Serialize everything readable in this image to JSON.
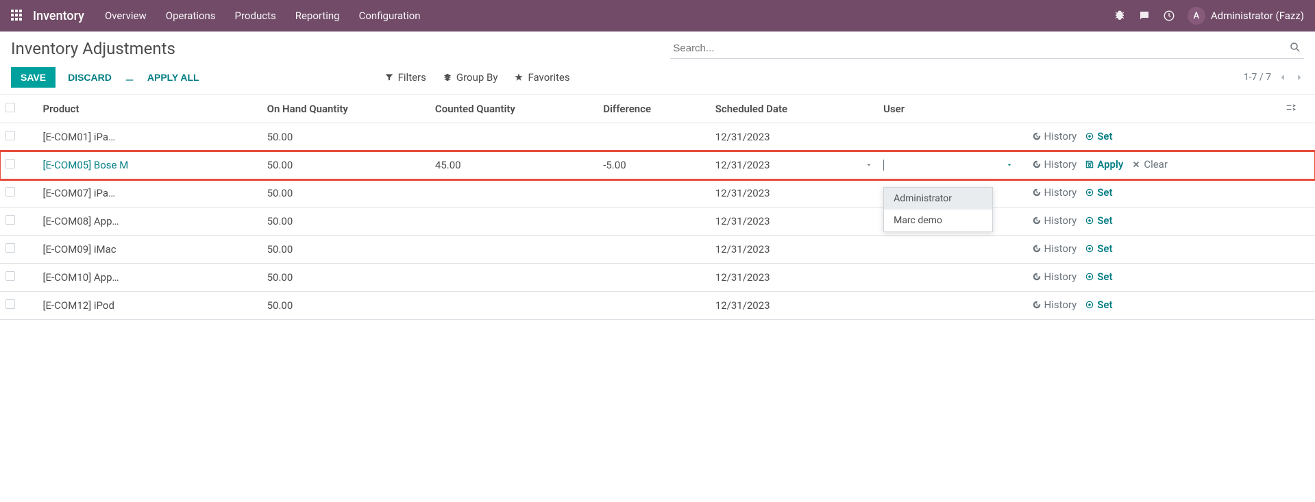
{
  "topnav": {
    "app": "Inventory",
    "menu": [
      "Overview",
      "Operations",
      "Products",
      "Reporting",
      "Configuration"
    ],
    "user_initial": "A",
    "user_label": "Administrator (Fazz)"
  },
  "cp": {
    "title": "Inventory Adjustments",
    "search_placeholder": "Search...",
    "save": "SAVE",
    "discard": "DISCARD",
    "apply_all": "APPLY ALL",
    "filters": "Filters",
    "groupby": "Group By",
    "favorites": "Favorites",
    "pager": "1-7 / 7"
  },
  "table": {
    "headers": {
      "product": "Product",
      "onhand": "On Hand Quantity",
      "counted": "Counted Quantity",
      "diff": "Difference",
      "date": "Scheduled Date",
      "user": "User"
    },
    "history": "History",
    "set": "Set",
    "apply": "Apply",
    "clear": "Clear",
    "rows": [
      {
        "product": "[E-COM01] iPa…",
        "onhand": "50.00",
        "counted": "",
        "diff": "",
        "date": "12/31/2023",
        "active": false
      },
      {
        "product": "[E-COM05] Bose M",
        "onhand": "50.00",
        "counted": "45.00",
        "diff": "-5.00",
        "date": "12/31/2023",
        "active": true
      },
      {
        "product": "[E-COM07] iPa…",
        "onhand": "50.00",
        "counted": "",
        "diff": "",
        "date": "12/31/2023",
        "active": false
      },
      {
        "product": "[E-COM08] App…",
        "onhand": "50.00",
        "counted": "",
        "diff": "",
        "date": "12/31/2023",
        "active": false
      },
      {
        "product": "[E-COM09] iMac",
        "onhand": "50.00",
        "counted": "",
        "diff": "",
        "date": "12/31/2023",
        "active": false
      },
      {
        "product": "[E-COM10] App…",
        "onhand": "50.00",
        "counted": "",
        "diff": "",
        "date": "12/31/2023",
        "active": false
      },
      {
        "product": "[E-COM12] iPod",
        "onhand": "50.00",
        "counted": "",
        "diff": "",
        "date": "12/31/2023",
        "active": false
      }
    ]
  },
  "dropdown": {
    "items": [
      "Administrator",
      "Marc demo"
    ]
  }
}
